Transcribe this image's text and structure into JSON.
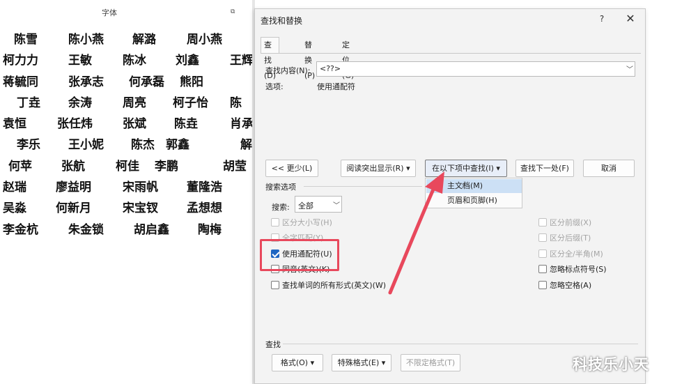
{
  "document": {
    "ribbon_font_group": "字体",
    "ribbon_launcher": "⧉",
    "rows": [
      [
        "陈雪",
        "陈小燕",
        "解潞",
        "周小燕"
      ],
      [
        "柯力力",
        "王敏",
        "陈冰",
        "刘鑫",
        "王辉"
      ],
      [
        "蒋毓同",
        "张承志",
        "何承磊",
        "熊阳"
      ],
      [
        "丁垚",
        "余涛",
        "周亮",
        "柯子怡",
        "陈"
      ],
      [
        "袁恒",
        "张任炜",
        "张斌",
        "陈垚",
        "肖承"
      ],
      [
        "李乐",
        "王小妮",
        "陈杰",
        "郭鑫",
        "解"
      ],
      [
        "何苹",
        "张航",
        "柯佳",
        "李鹏",
        "胡莹"
      ],
      [
        "赵瑞",
        "廖益明",
        "宋雨帆",
        "董隆浩"
      ],
      [
        "吴淼",
        "何新月",
        "宋宝钗",
        "孟想想"
      ],
      [
        "李金杭",
        "朱金锁",
        "胡启鑫",
        "陶梅"
      ]
    ]
  },
  "dialog": {
    "title": "查找和替换",
    "help": "?",
    "close": "✕",
    "tabs": [
      "查找(D)",
      "替换(P)",
      "定位(G)"
    ],
    "find_label": "查找内容(N):",
    "find_value": "<??>",
    "options_label": "选项:",
    "options_value": "使用通配符",
    "buttons": {
      "less": "<< 更少(L)",
      "highlight": "阅读突出显示(R) ▾",
      "find_in": "在以下项中查找(I) ▾",
      "find_next": "查找下一处(F)",
      "cancel": "取消"
    },
    "find_in_menu": [
      "主文档(M)",
      "页眉和页脚(H)"
    ],
    "search_section": "搜索选项",
    "scope_label": "搜索:",
    "scope_value": "全部",
    "left_options": [
      {
        "label": "区分大小写(H)",
        "checked": false,
        "disabled": true
      },
      {
        "label": "全字匹配(Y)",
        "checked": false,
        "disabled": true
      },
      {
        "label": "使用通配符(U)",
        "checked": true,
        "disabled": false
      },
      {
        "label": "同音(英文)(K)",
        "checked": false,
        "disabled": false
      },
      {
        "label": "查找单词的所有形式(英文)(W)",
        "checked": false,
        "disabled": false
      }
    ],
    "right_options": [
      {
        "label": "区分前缀(X)",
        "checked": false,
        "disabled": true
      },
      {
        "label": "区分后缀(T)",
        "checked": false,
        "disabled": true
      },
      {
        "label": "区分全/半角(M)",
        "checked": false,
        "disabled": true
      },
      {
        "label": "忽略标点符号(S)",
        "checked": false,
        "disabled": false
      },
      {
        "label": "忽略空格(A)",
        "checked": false,
        "disabled": false
      }
    ],
    "bottom_section": "查找",
    "bottom_buttons": {
      "format": "格式(O) ▾",
      "special": "特殊格式(E) ▾",
      "no_format": "不限定格式(T)"
    }
  },
  "colors": {
    "highlight_box": "#e8485c",
    "checkbox_checked": "#1f66c2",
    "menu_hover": "#cce0f5"
  },
  "watermark": "科技乐小天"
}
